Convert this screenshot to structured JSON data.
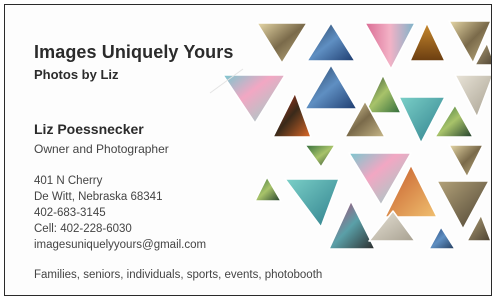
{
  "business": {
    "name": "Images Uniquely Yours",
    "subtitle": "Photos by Liz"
  },
  "person": {
    "name": "Liz Poessnecker",
    "title": "Owner and Photographer"
  },
  "contact": {
    "street": "401 N Cherry",
    "city": "De Witt, Nebraska 68341",
    "phone": "402-683-3145",
    "cell": "Cell: 402-228-6030",
    "email": "imagesuniquelyyours@gmail.com"
  },
  "services": "Families, seniors, individuals, sports, events, photobooth",
  "colors": {
    "text": "#2b2b2b",
    "secondary_text": "#444444",
    "card_border": "#2a2a2a"
  },
  "artwork": {
    "description_icon": "triangle-mosaic-graphic"
  }
}
